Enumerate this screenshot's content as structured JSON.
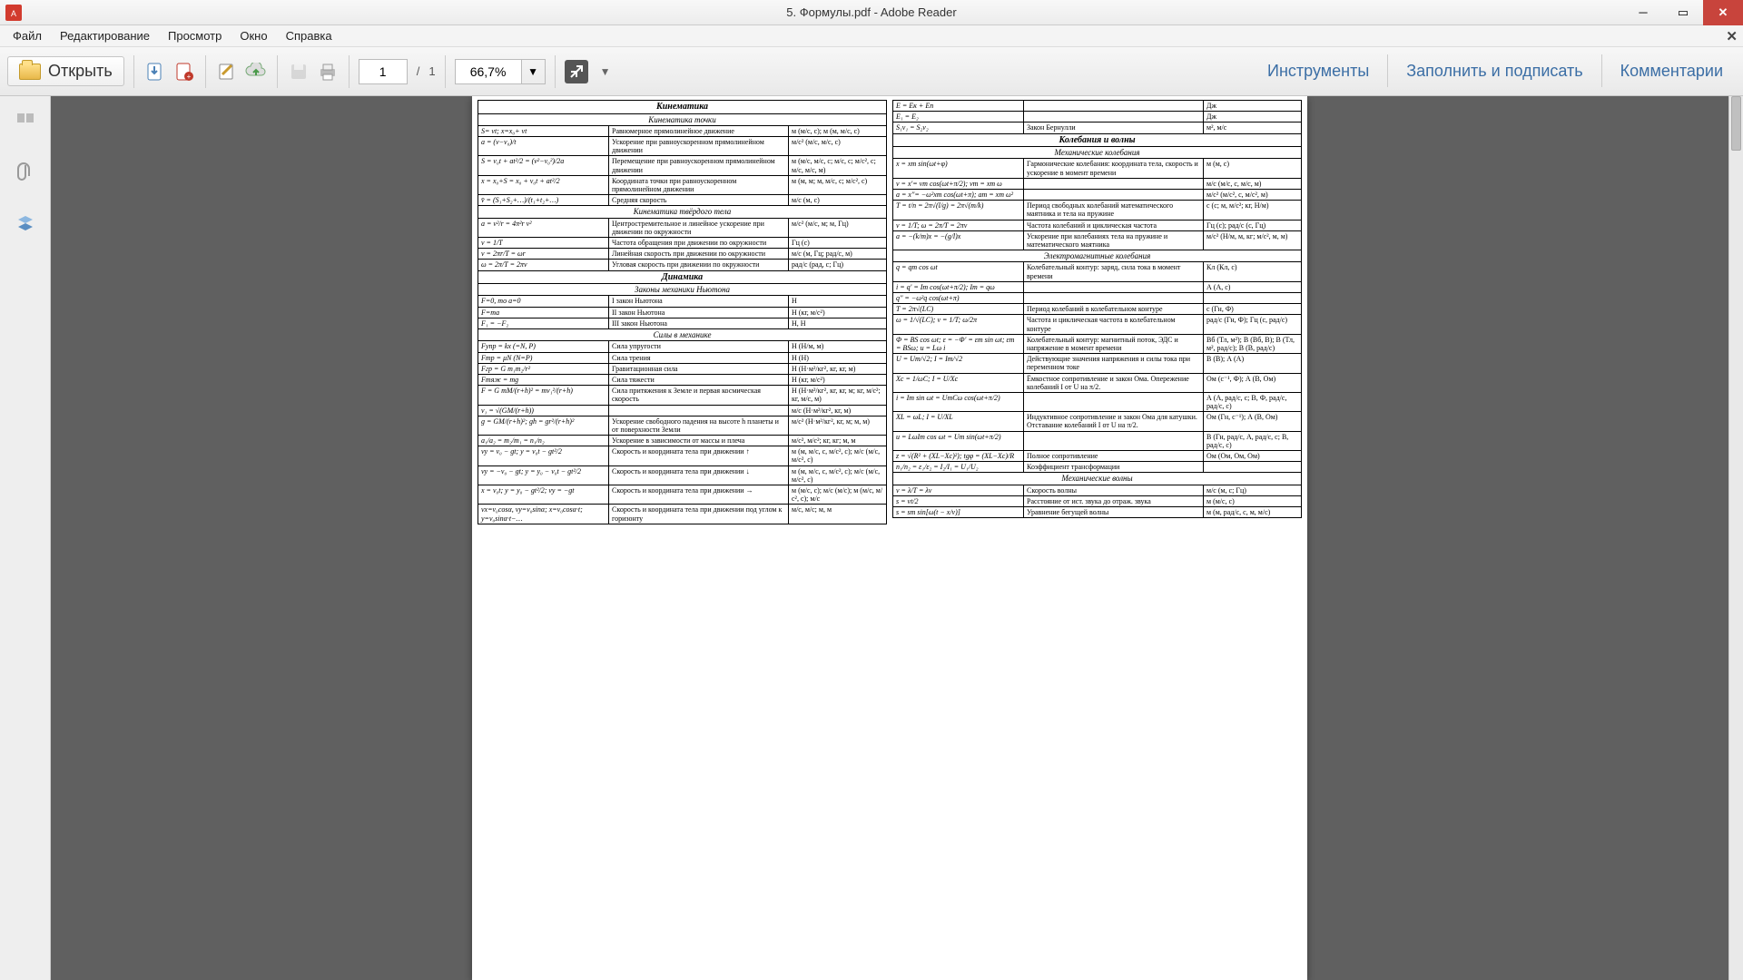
{
  "window": {
    "title": "5. Формулы.pdf - Adobe Reader"
  },
  "menu": {
    "file": "Файл",
    "edit": "Редактирование",
    "view": "Просмотр",
    "window": "Окно",
    "help": "Справка"
  },
  "toolbar": {
    "open": "Открыть",
    "page_current": "1",
    "page_sep": "/",
    "page_total": "1",
    "zoom": "66,7%",
    "tools": "Инструменты",
    "fill_sign": "Заполнить и подписать",
    "comments": "Комментарии"
  },
  "doc": {
    "left_sections": [
      {
        "title": "Кинематика",
        "sub": "Кинематика точки",
        "rows": [
          {
            "f": "S= vt;   x=x₀+ vt",
            "d": "Равномерное прямолинейное движение",
            "u": "м (м/с, с);   м (м, м/с, с)"
          },
          {
            "f": "a = (v−v₀)/t",
            "d": "Ускорение при равноускоренном прямолинейном движении",
            "u": "м/с² (м/с, м/с, с)"
          },
          {
            "f": "S = v₀t + at²/2 = (v²−v₀²)/2a",
            "d": "Перемещение при равноускоренном прямолинейном движении",
            "u": "м (м/с, м/с, с; м/с, с; м/с², с; м/с, м/с, м)"
          },
          {
            "f": "x = x₀+S = x₀ + v₀t + at²/2",
            "d": "Координата точки при равноускоренном прямолинейном движении",
            "u": "м (м, м; м, м/с, с; м/с², с)"
          },
          {
            "f": "v̄ = (S₁+S₂+…)/(t₁+t₂+…)",
            "d": "Средняя скорость",
            "u": "м/с (м, с)"
          }
        ]
      },
      {
        "sub": "Кинематика твёрдого тела",
        "rows": [
          {
            "f": "a = v²/r = 4π²r ν²",
            "d": "Центростремительное и линейное ускорение при движении по окружности",
            "u": "м/с² (м/с, м; м, Гц)"
          },
          {
            "f": "ν = 1/T",
            "d": "Частота обращения при движении по окружности",
            "u": "Гц (с)"
          },
          {
            "f": "v = 2πr/T = ωr",
            "d": "Линейная скорость при движении по окружности",
            "u": "м/с (м, Гц; рад/с, м)"
          },
          {
            "f": "ω = 2π/T = 2πν",
            "d": "Угловая скорость при движении по окружности",
            "u": "рад/с (рад, с; Гц)"
          }
        ]
      },
      {
        "title": "Динамика",
        "sub": "Законы механики Ньютона",
        "rows": [
          {
            "f": "F=0, то a=0",
            "d": "I закон Ньютона",
            "u": "Н"
          },
          {
            "f": "F=ma",
            "d": "II закон Ньютона",
            "u": "Н (кг, м/с²)"
          },
          {
            "f": "F₁ = −F₂",
            "d": "III закон Ньютона",
            "u": "Н, Н"
          }
        ]
      },
      {
        "sub": "Силы в механике",
        "rows": [
          {
            "f": "Fупр = kx (=N, P)",
            "d": "Сила упругости",
            "u": "Н (Н/м, м)"
          },
          {
            "f": "Fтр = μN (N=P)",
            "d": "Сила трения",
            "u": "Н (Н)"
          },
          {
            "f": "Fгр = G m₁m₂/r²",
            "d": "Гравитационная сила",
            "u": "Н (Н·м²/кг², кг, кг, м)"
          },
          {
            "f": "Fтяж = mg",
            "d": "Сила тяжести",
            "u": "Н (кг, м/с²)"
          },
          {
            "f": "F = G mM/(r+h)² = mv₁²/(r+h)",
            "d": "Сила притяжения к Земле и первая космическая скорость",
            "u": "Н (Н·м²/кг², кг, кг, м; кг, м/с²; кг, м/с, м)"
          },
          {
            "f": "v₁ = √(GM/(r+h))",
            "d": "",
            "u": "м/с (Н·м²/кг², кг, м)"
          },
          {
            "f": "g = GM/(r+h)²;  gh = gr²/(r+h)²",
            "d": "Ускорение свободного падения на высоте h планеты и от поверхности Земли",
            "u": "м/с² (Н·м²/кг², кг, м; м, м)"
          },
          {
            "f": "a₁/a₂ = m₂/m₁ = n₁/n₂",
            "d": "Ускорение в зависимости от массы и плеча",
            "u": "м/с², м/с²; кг, кг; м, м"
          },
          {
            "f": "vy = v₀ − gt;   y = v₀t − gt²/2",
            "d": "Скорость и координата тела при движении ↑",
            "u": "м (м, м/с, с, м/с², с);   м/с (м/с, м/с², с)"
          },
          {
            "f": "vy = −v₀ − gt;  y = y₀ − v₀t − gt²/2",
            "d": "Скорость и координата тела при движении ↓",
            "u": "м (м, м/с, с, м/с², с);   м/с (м/с, м/с², с)"
          },
          {
            "f": "x = v₀t;   y = y₀ − gt²/2;  vy = −gt",
            "d": "Скорость и координата тела при движении →",
            "u": "м (м/с, с); м/с (м/с); м (м/с, м/с², с); м/с"
          },
          {
            "f": "vx=v₀cosα, vy=v₀sinα; x=v₀cosα·t; y=v₀sinα·t−…",
            "d": "Скорость и координата тела при движении под углом к горизонту",
            "u": "м/с, м/с; м, м"
          }
        ]
      }
    ],
    "right_sections": [
      {
        "rows": [
          {
            "f": "E = Eк + Eп",
            "d": "",
            "u": "Дж"
          },
          {
            "f": "E₁ = E₂",
            "d": "",
            "u": "Дж"
          },
          {
            "f": "S₁v₁ = S₂v₂",
            "d": "Закон Бернулли",
            "u": "м², м/с"
          }
        ]
      },
      {
        "title": "Колебания и волны",
        "sub": "Механические колебания",
        "rows": [
          {
            "f": "x = xm sin(ωt+φ)",
            "d": "Гармонические колебания: координата тела, скорость и ускорение в момент времени",
            "u": "м (м, с)"
          },
          {
            "f": "v = x'= vm cos(ωt+π/2); vm = xm ω",
            "d": "",
            "u": "м/с (м/с, с, м/с, м)"
          },
          {
            "f": "a = x''= −ω²xm cos(ωt+π); am = xm ω²",
            "d": "",
            "u": "м/с² (м/с², с, м/с², м)"
          },
          {
            "f": "T = t/n = 2π√(l/g) = 2π√(m/k)",
            "d": "Период свободных колебаний математического маятника и тела на пружине",
            "u": "с (с; м, м/с²; кг, Н/м)"
          },
          {
            "f": "ν = 1/T;  ω = 2π/T = 2πν",
            "d": "Частота колебаний и циклическая частота",
            "u": "Гц (с); рад/с (с, Гц)"
          },
          {
            "f": "a = −(k/m)x = −(g/l)x",
            "d": "Ускорение при колебаниях тела на пружине и математического маятника",
            "u": "м/с² (Н/м, м, кг; м/с², м, м)"
          }
        ]
      },
      {
        "sub": "Электромагнитные колебания",
        "rows": [
          {
            "f": "q = qm cos ωt",
            "d": "Колебательный контур: заряд, сила тока в момент времени",
            "u": "Кл (Кл, с)"
          },
          {
            "f": "i = q' = Im cos(ωt+π/2); Im = qω",
            "d": "",
            "u": "А (А, с)"
          },
          {
            "f": "q'' = −ω²q cos(ωt+π)",
            "d": "",
            "u": ""
          },
          {
            "f": "T = 2π√(LC)",
            "d": "Период колебаний в колебательном контуре",
            "u": "с (Гн, Ф)"
          },
          {
            "f": "ω = 1/√(LC);  ν = 1/T;  ω/2π",
            "d": "Частота и циклическая частота в колебательном контуре",
            "u": "рад/с (Гн, Ф); Гц (с, рад/с)"
          },
          {
            "f": "Φ = BS cos ωt;  ε = −Φ' = εm sin ωt; εm = BSω;  u = Lω i",
            "d": "Колебательный контур: магнитный поток, ЭДС и напряжение в момент времени",
            "u": "Вб (Тл, м²);  В (Вб, В); В (Тл, м², рад/с);  В (В, рад/с)"
          },
          {
            "f": "U = Um/√2;  I = Im/√2",
            "d": "Действующие значения напряжения и силы тока при переменном токе",
            "u": "В (В); А (А)"
          },
          {
            "f": "Xc = 1/ωC;  I = U/Xc",
            "d": "Ёмкостное сопротивление и закон Ома. Опережение колебаний I от U на π/2.",
            "u": "Ом (с⁻¹, Ф); А (В, Ом)"
          },
          {
            "f": "i = Im sin ωt = UmCω cos(ωt+π/2)",
            "d": "",
            "u": "А (А, рад/с, с; В, Ф, рад/с, рад/с, с)"
          },
          {
            "f": "XL = ωL;  I = U/XL",
            "d": "Индуктивное сопротивление и закон Ома для катушки. Отставание колебаний I от U на π/2.",
            "u": "Ом (Гн, с⁻¹); А (В, Ом)"
          },
          {
            "f": "u = LωIm cos ωt = Um sin(ωt+π/2)",
            "d": "",
            "u": "В (Гн, рад/с, А, рад/с, с; В, рад/с, с)"
          },
          {
            "f": "z = √(R² + (XL−Xc)²);  tgφ = (XL−Xc)/R",
            "d": "Полное сопротивление",
            "u": "Ом (Ом, Ом, Ом)"
          },
          {
            "f": "n₁/n₂ = ε₁/ε₂ = I₂/I₁ = U₁/U₂",
            "d": "Коэффициент трансформации",
            "u": ""
          }
        ]
      },
      {
        "sub": "Механические волны",
        "rows": [
          {
            "f": "v = λ/T = λν",
            "d": "Скорость волны",
            "u": "м/с (м, с; Гц)"
          },
          {
            "f": "s = vt/2",
            "d": "Расстояние от ист. звука до отраж. звука",
            "u": "м (м/с, с)"
          },
          {
            "f": "s = sm sin[ω(t − x/v)]",
            "d": "Уравнение бегущей волны",
            "u": "м (м, рад/с, с, м, м/с)"
          }
        ]
      }
    ]
  }
}
